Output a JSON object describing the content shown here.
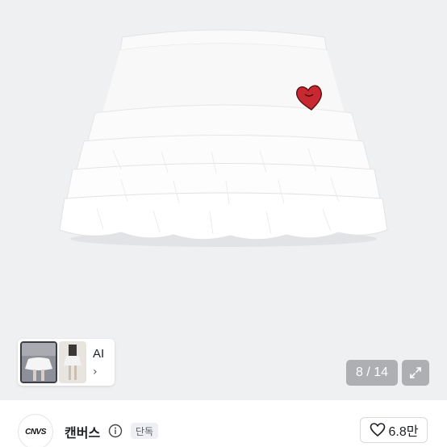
{
  "product_image": {
    "icon": "white-ruffle-skirt-with-red-heart-patch",
    "accent_color": "#c8282f"
  },
  "thumbnails": {
    "ai_label": "AI",
    "chevron_glyph": "›"
  },
  "gallery": {
    "counter_text": "8 / 14",
    "expand_icon": "expand-arrows-icon"
  },
  "shop": {
    "logo_text": "CNVS",
    "name": "캔버스",
    "badge": "단독",
    "info_icon": "info-icon"
  },
  "like": {
    "icon": "heart-outline-icon",
    "count": "6.8만"
  }
}
